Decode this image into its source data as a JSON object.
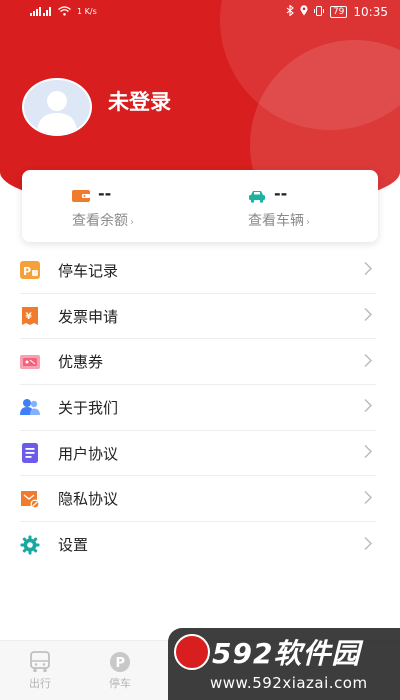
{
  "status_bar": {
    "carrier_signal": "4G",
    "net_speed": "1 K/s",
    "battery": "79",
    "time": "10:35"
  },
  "profile": {
    "username": "未登录"
  },
  "summary": {
    "balance": {
      "value": "--",
      "link": "查看余额"
    },
    "vehicle": {
      "value": "--",
      "link": "查看车辆"
    }
  },
  "menu": [
    {
      "label": "停车记录",
      "icon": "parking-record-icon",
      "color": "#f39a2e"
    },
    {
      "label": "发票申请",
      "icon": "invoice-icon",
      "color": "#f07b2d"
    },
    {
      "label": "优惠券",
      "icon": "coupon-icon",
      "color": "#f2627a"
    },
    {
      "label": "关于我们",
      "icon": "about-us-icon",
      "color": "#3f7ff5"
    },
    {
      "label": "用户协议",
      "icon": "user-agreement-icon",
      "color": "#6c5ce7"
    },
    {
      "label": "隐私协议",
      "icon": "privacy-icon",
      "color": "#f07b2d"
    },
    {
      "label": "设置",
      "icon": "settings-icon",
      "color": "#19a8a0"
    }
  ],
  "bottom_nav": [
    {
      "label": "出行",
      "icon": "bus-icon"
    },
    {
      "label": "停车",
      "icon": "parking-icon"
    }
  ],
  "watermark": {
    "title": "592软件园",
    "url": "www.592xiazai.com"
  },
  "colors": {
    "brand_red": "#d81e1e",
    "text_gray": "#8a8a8a"
  }
}
